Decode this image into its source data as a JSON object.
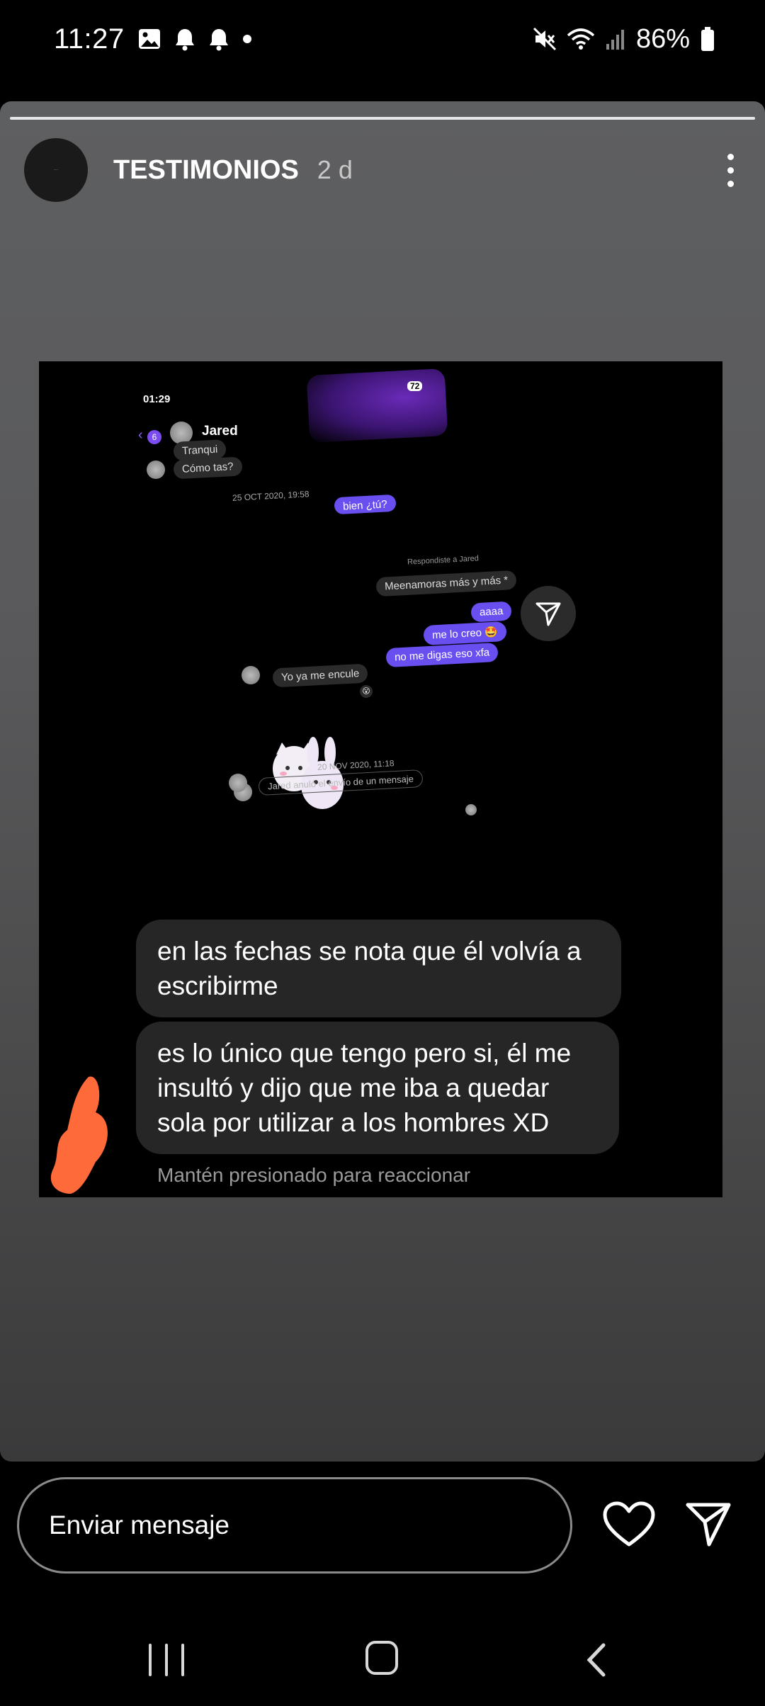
{
  "status_bar": {
    "time": "11:27",
    "battery_percent": "86%",
    "icons": [
      "gallery-icon",
      "bell-icon",
      "bell-icon",
      "dot-icon",
      "mute-icon",
      "wifi-icon",
      "signal-icon",
      "battery-icon"
    ]
  },
  "story": {
    "username": "TESTIMONIOS",
    "age": "2 d",
    "progress_segments": 1
  },
  "screenshot": {
    "inner_chat": {
      "time": "01:29",
      "battery": "72",
      "back_badge": "6",
      "contact_name": "Jared",
      "messages": [
        {
          "text": "Tranqui",
          "side": "left"
        },
        {
          "text": "Cómo tas?",
          "side": "left"
        },
        {
          "text": "25 OCT 2020, 19:58",
          "type": "date"
        },
        {
          "text": "bien ¿tú?",
          "side": "right"
        },
        {
          "text": "Respondiste a Jared",
          "type": "reply-label"
        },
        {
          "text": "Meenamoras más y más *",
          "side": "right-quote"
        },
        {
          "text": "aaaa",
          "side": "right"
        },
        {
          "text": "me lo creo 🤩",
          "side": "right"
        },
        {
          "text": "no me digas eso xfa",
          "side": "right"
        },
        {
          "text": "Yo ya me encule",
          "side": "left"
        },
        {
          "text": "20 NOV 2020, 11:18",
          "type": "date"
        },
        {
          "text": "Jared anuló el envío de un mensaje",
          "type": "system"
        }
      ]
    },
    "messages": [
      {
        "text": "en las fechas se nota que él volvía a escribirme"
      },
      {
        "text": "es lo único que tengo pero si, él me insultó y dijo que me iba a quedar sola por utilizar a los hombres XD"
      }
    ],
    "hint": "Mantén presionado para reaccionar"
  },
  "footer": {
    "message_placeholder": "Enviar mensaje"
  },
  "colors": {
    "story_bg": "#5e5f61",
    "bubble_gray": "#262626",
    "bubble_purple": "#6a4ff0",
    "scribble": "#ff6a3a"
  }
}
